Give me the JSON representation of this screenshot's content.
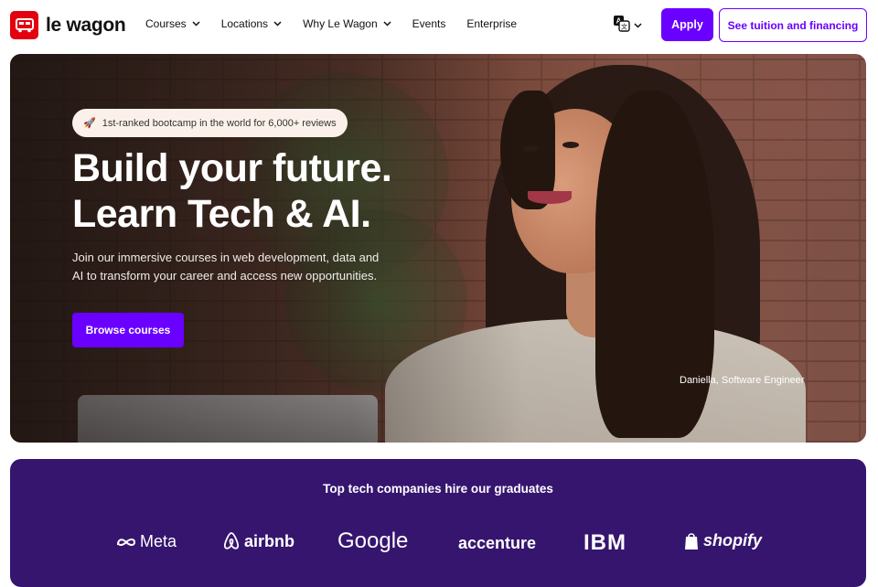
{
  "brand": {
    "name": "le wagon",
    "accent": "#6a00ff",
    "logo_color": "#e3000f",
    "band_color": "#36156f"
  },
  "nav": {
    "items": [
      {
        "label": "Courses",
        "has_dropdown": true
      },
      {
        "label": "Locations",
        "has_dropdown": true
      },
      {
        "label": "Why Le Wagon",
        "has_dropdown": true
      },
      {
        "label": "Events",
        "has_dropdown": false
      },
      {
        "label": "Enterprise",
        "has_dropdown": false
      }
    ],
    "language_icon": "translate-icon",
    "apply_label": "Apply",
    "tuition_label": "See tuition and financing"
  },
  "hero": {
    "badge_icon": "rocket-icon",
    "badge_text": "1st-ranked bootcamp in the world for 6,000+ reviews",
    "title_line1": "Build your future.",
    "title_line2": "Learn Tech & AI.",
    "subtitle": "Join our immersive courses in web development, data and AI to transform your career and access new opportunities.",
    "cta_label": "Browse courses",
    "caption": "Daniella, Software Engineer"
  },
  "companies": {
    "title": "Top tech companies hire our graduates",
    "logos": [
      "Meta",
      "airbnb",
      "Google",
      "accenture",
      "IBM",
      "shopify"
    ]
  }
}
